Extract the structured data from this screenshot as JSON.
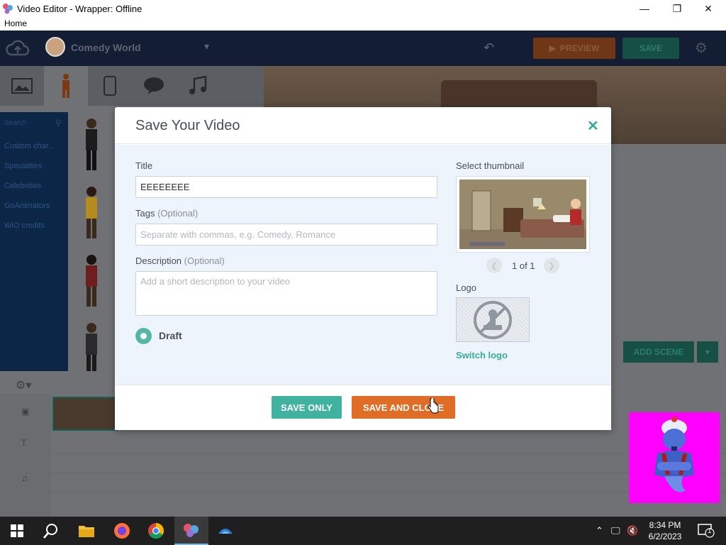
{
  "window": {
    "title": "Video Editor - Wrapper: Offline",
    "menu_home": "Home",
    "controls": {
      "minimize": "—",
      "maximize": "❐",
      "close": "✕"
    }
  },
  "editor": {
    "project_name": "Comedy World",
    "preview_label": "PREVIEW",
    "save_label": "SAVE",
    "add_scene_label": "ADD SCENE",
    "char_search_placeholder": "Search",
    "char_categories": [
      "Custom char...",
      "Specialties",
      "Celebrities",
      "GoAnimators",
      "WiO credits"
    ]
  },
  "modal": {
    "title": "Save Your Video",
    "close_symbol": "✕",
    "title_label": "Title",
    "title_value": "EEEEEEEE",
    "tags_label": "Tags",
    "tags_optional": "(Optional)",
    "tags_placeholder": "Separate with commas, e.g. Comedy, Romance",
    "description_label": "Description",
    "description_optional": "(Optional)",
    "description_placeholder": "Add a short description to your video",
    "draft_label": "Draft",
    "thumbnail_label": "Select thumbnail",
    "thumbnail_count": "1 of 1",
    "logo_label": "Logo",
    "switch_logo": "Switch logo",
    "save_only": "SAVE ONLY",
    "save_and_close": "SAVE AND CLOSE"
  },
  "taskbar": {
    "time": "8:34 PM",
    "date": "6/2/2023",
    "notification_count": "1",
    "accent": "#76b9ed"
  },
  "colors": {
    "teal": "#3fb2a0",
    "orange": "#e06d25",
    "overlay_magenta": "#ff00ff"
  }
}
